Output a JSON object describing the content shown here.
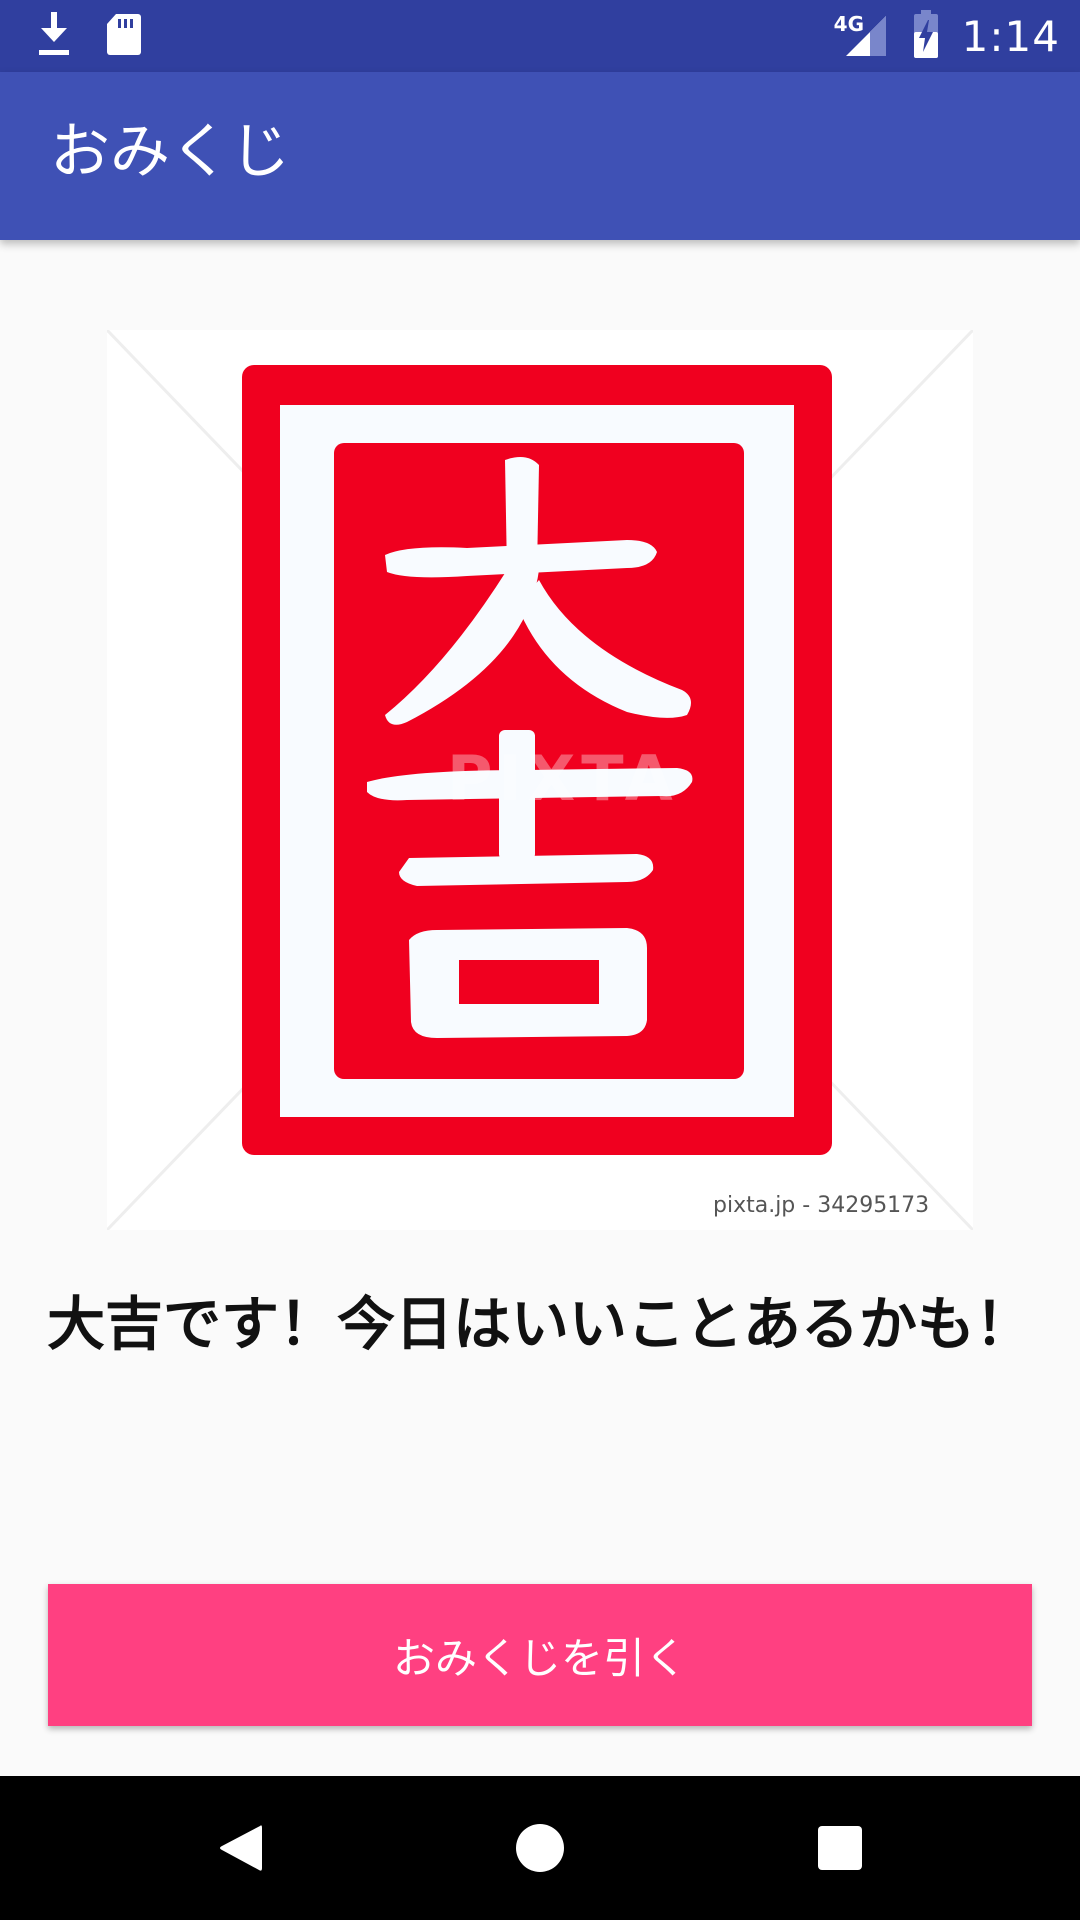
{
  "status_bar": {
    "time": "1:14",
    "network": "4G",
    "icons": [
      "download-icon",
      "sd-card-icon",
      "signal-icon",
      "battery-charging-icon"
    ]
  },
  "app_bar": {
    "title": "おみくじ"
  },
  "fortune": {
    "image_characters": "大吉",
    "watermark": "PIXTA",
    "credit": "pixta.jp - 34295173",
    "result_message": "大吉です！今日はいいことあるかも！"
  },
  "actions": {
    "draw_button_label": "おみくじを引く"
  },
  "nav_bar": {
    "icons": [
      "back-icon",
      "home-icon",
      "recents-icon"
    ]
  },
  "colors": {
    "status_bar": "#303f9f",
    "app_bar": "#3f51b5",
    "accent": "#ff4081",
    "stamp_red": "#f0001f"
  }
}
